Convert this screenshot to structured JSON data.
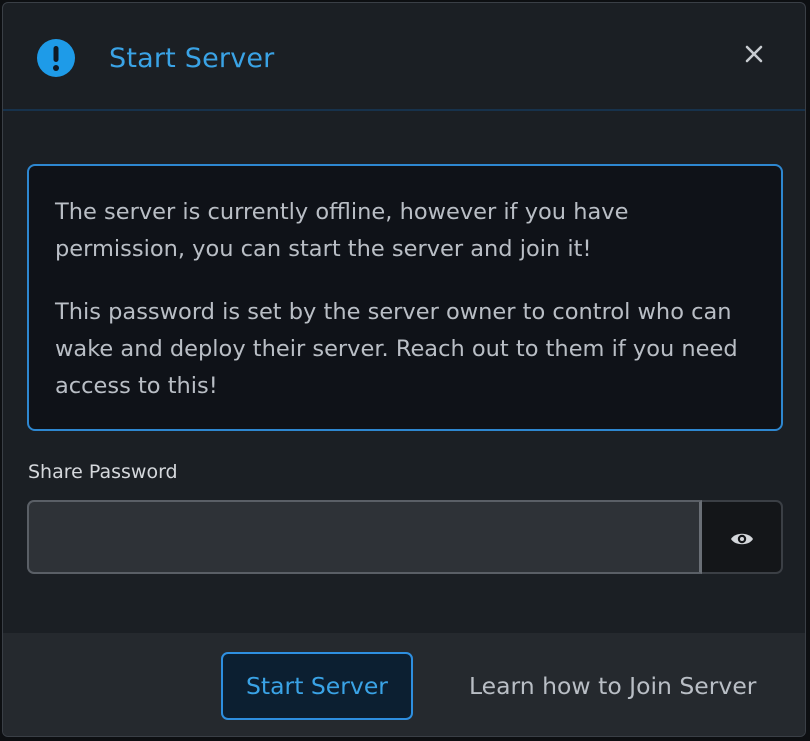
{
  "dialog": {
    "title": "Start Server",
    "icons": {
      "alert": "exclamation-circle-icon",
      "close": "close-icon",
      "toggle_visibility": "eye-icon"
    },
    "colors": {
      "accent": "#3aa3e6",
      "background": "#1b1f24",
      "info_border": "#2e87d0"
    }
  },
  "info": {
    "paragraph_1": "The server is currently offline, however if you have permission, you can start the server and join it!",
    "paragraph_2": "This password is set by the server owner to control who can wake and deploy their server. Reach out to them if you need access to this!"
  },
  "password": {
    "label": "Share Password",
    "value": "",
    "placeholder": ""
  },
  "footer": {
    "start_label": "Start Server",
    "learn_label": "Learn how to Join Server"
  }
}
